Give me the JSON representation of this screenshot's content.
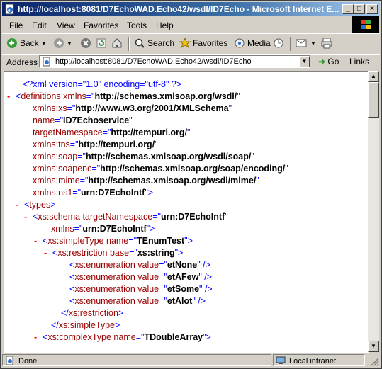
{
  "window": {
    "title": "http://localhost:8081/D7EchoWAD.Echo42/wsdl/ID7Echo - Microsoft Internet E...",
    "min_glyph": "_",
    "max_glyph": "□",
    "close_glyph": "×"
  },
  "menu": [
    "File",
    "Edit",
    "View",
    "Favorites",
    "Tools",
    "Help"
  ],
  "toolbar": {
    "back": "Back",
    "search": "Search",
    "favorites": "Favorites",
    "media": "Media"
  },
  "address": {
    "label": "Address",
    "url": "http://localhost:8081/D7EchoWAD.Echo42/wsdl/ID7Echo",
    "go": "Go",
    "links": "Links"
  },
  "xml_lines": [
    {
      "marker": "",
      "tokens": [
        [
          "b",
          "<?xml version=\"1.0\" encoding=\"utf-8\" ?>"
        ]
      ]
    },
    {
      "marker": "-",
      "tokens": [
        [
          "b",
          "<"
        ],
        [
          "t",
          "definitions"
        ],
        [
          "an",
          " xmlns"
        ],
        [
          "b",
          "=\""
        ],
        [
          "av",
          "http://schemas.xmlsoap.org/wsdl/"
        ],
        [
          "b",
          "\""
        ]
      ]
    },
    {
      "marker": "",
      "tokens": [
        [
          "an",
          "xmlns:xs"
        ],
        [
          "b",
          "=\""
        ],
        [
          "av",
          "http://www.w3.org/2001/XMLSchema"
        ],
        [
          "b",
          "\""
        ]
      ]
    },
    {
      "marker": "",
      "tokens": [
        [
          "an",
          "name"
        ],
        [
          "b",
          "=\""
        ],
        [
          "av",
          "ID7Echoservice"
        ],
        [
          "b",
          "\""
        ]
      ]
    },
    {
      "marker": "",
      "tokens": [
        [
          "an",
          "targetNamespace"
        ],
        [
          "b",
          "=\""
        ],
        [
          "av",
          "http://tempuri.org/"
        ],
        [
          "b",
          "\""
        ]
      ]
    },
    {
      "marker": "",
      "tokens": [
        [
          "an",
          "xmlns:tns"
        ],
        [
          "b",
          "=\""
        ],
        [
          "av",
          "http://tempuri.org/"
        ],
        [
          "b",
          "\""
        ]
      ]
    },
    {
      "marker": "",
      "tokens": [
        [
          "an",
          "xmlns:soap"
        ],
        [
          "b",
          "=\""
        ],
        [
          "av",
          "http://schemas.xmlsoap.org/wsdl/soap/"
        ],
        [
          "b",
          "\""
        ]
      ]
    },
    {
      "marker": "",
      "tokens": [
        [
          "an",
          "xmlns:soapenc"
        ],
        [
          "b",
          "=\""
        ],
        [
          "av",
          "http://schemas.xmlsoap.org/soap/encoding/"
        ],
        [
          "b",
          "\""
        ]
      ]
    },
    {
      "marker": "",
      "tokens": [
        [
          "an",
          "xmlns:mime"
        ],
        [
          "b",
          "=\""
        ],
        [
          "av",
          "http://schemas.xmlsoap.org/wsdl/mime/"
        ],
        [
          "b",
          "\""
        ]
      ]
    },
    {
      "marker": "",
      "tokens": [
        [
          "an",
          "xmlns:ns1"
        ],
        [
          "b",
          "=\""
        ],
        [
          "av",
          "urn:D7EchoIntf"
        ],
        [
          "b",
          "\">"
        ]
      ]
    },
    {
      "marker": "-",
      "tokens": [
        [
          "b",
          "<"
        ],
        [
          "t",
          "types"
        ],
        [
          "b",
          ">"
        ]
      ]
    },
    {
      "marker": "-",
      "tokens": [
        [
          "b",
          "<"
        ],
        [
          "t",
          "xs:schema"
        ],
        [
          "an",
          " targetNamespace"
        ],
        [
          "b",
          "=\""
        ],
        [
          "av",
          "urn:D7EchoIntf"
        ],
        [
          "b",
          "\""
        ]
      ]
    },
    {
      "marker": "",
      "tokens": [
        [
          "an",
          "xmlns"
        ],
        [
          "b",
          "=\""
        ],
        [
          "av",
          "urn:D7EchoIntf"
        ],
        [
          "b",
          "\">"
        ]
      ]
    },
    {
      "marker": "-",
      "tokens": [
        [
          "b",
          "<"
        ],
        [
          "t",
          "xs:simpleType"
        ],
        [
          "an",
          " name"
        ],
        [
          "b",
          "=\""
        ],
        [
          "av",
          "TEnumTest"
        ],
        [
          "b",
          "\">"
        ]
      ]
    },
    {
      "marker": "-",
      "tokens": [
        [
          "b",
          "<"
        ],
        [
          "t",
          "xs:restriction"
        ],
        [
          "an",
          " base"
        ],
        [
          "b",
          "=\""
        ],
        [
          "av",
          "xs:string"
        ],
        [
          "b",
          "\">"
        ]
      ]
    },
    {
      "marker": "",
      "tokens": [
        [
          "b",
          "<"
        ],
        [
          "t",
          "xs:enumeration"
        ],
        [
          "an",
          " value"
        ],
        [
          "b",
          "=\""
        ],
        [
          "av",
          "etNone"
        ],
        [
          "b",
          "\" />"
        ]
      ]
    },
    {
      "marker": "",
      "tokens": [
        [
          "b",
          "<"
        ],
        [
          "t",
          "xs:enumeration"
        ],
        [
          "an",
          " value"
        ],
        [
          "b",
          "=\""
        ],
        [
          "av",
          "etAFew"
        ],
        [
          "b",
          "\" />"
        ]
      ]
    },
    {
      "marker": "",
      "tokens": [
        [
          "b",
          "<"
        ],
        [
          "t",
          "xs:enumeration"
        ],
        [
          "an",
          " value"
        ],
        [
          "b",
          "=\""
        ],
        [
          "av",
          "etSome"
        ],
        [
          "b",
          "\" />"
        ]
      ]
    },
    {
      "marker": "",
      "tokens": [
        [
          "b",
          "<"
        ],
        [
          "t",
          "xs:enumeration"
        ],
        [
          "an",
          " value"
        ],
        [
          "b",
          "=\""
        ],
        [
          "av",
          "etAlot"
        ],
        [
          "b",
          "\" />"
        ]
      ]
    },
    {
      "marker": "",
      "tokens": [
        [
          "b",
          "</"
        ],
        [
          "t",
          "xs:restriction"
        ],
        [
          "b",
          ">"
        ]
      ]
    },
    {
      "marker": "",
      "tokens": [
        [
          "b",
          "</"
        ],
        [
          "t",
          "xs:simpleType"
        ],
        [
          "b",
          ">"
        ]
      ]
    },
    {
      "marker": "-",
      "tokens": [
        [
          "b",
          "<"
        ],
        [
          "t",
          "xs:complexType"
        ],
        [
          "an",
          " name"
        ],
        [
          "b",
          "=\""
        ],
        [
          "av",
          "TDoubleArray"
        ],
        [
          "b",
          "\">"
        ]
      ]
    }
  ],
  "status": {
    "text": "Done",
    "zone": "Local intranet"
  }
}
